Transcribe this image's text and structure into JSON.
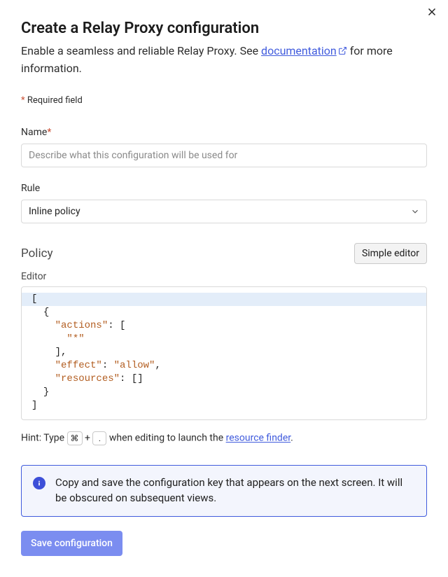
{
  "dialog": {
    "title": "Create a Relay Proxy configuration",
    "subtitle_prefix": "Enable a seamless and reliable Relay Proxy. See ",
    "subtitle_link": "documentation",
    "subtitle_suffix": " for more information.",
    "required_note": "Required field"
  },
  "form": {
    "name_label": "Name",
    "name_placeholder": "Describe what this configuration will be used for",
    "name_value": "",
    "rule_label": "Rule",
    "rule_selected": "Inline policy"
  },
  "policy": {
    "section_title": "Policy",
    "simple_editor_button": "Simple editor",
    "editor_label": "Editor",
    "code_tokens": [
      {
        "nl": true
      },
      {
        "punc": "["
      },
      {
        "nl": true
      },
      {
        "indent": 1
      },
      {
        "punc": "{"
      },
      {
        "nl": true
      },
      {
        "indent": 2
      },
      {
        "key": "\"actions\""
      },
      {
        "punc": ": ["
      },
      {
        "nl": true
      },
      {
        "indent": 3
      },
      {
        "str": "\"*\""
      },
      {
        "nl": true
      },
      {
        "indent": 2
      },
      {
        "punc": "],"
      },
      {
        "nl": true
      },
      {
        "indent": 2
      },
      {
        "key": "\"effect\""
      },
      {
        "punc": ": "
      },
      {
        "str": "\"allow\""
      },
      {
        "punc": ","
      },
      {
        "nl": true
      },
      {
        "indent": 2
      },
      {
        "key": "\"resources\""
      },
      {
        "punc": ": []"
      },
      {
        "nl": true
      },
      {
        "indent": 1
      },
      {
        "punc": "}"
      },
      {
        "nl": true
      },
      {
        "punc": "]"
      }
    ],
    "hint_prefix": "Hint: Type ",
    "hint_key1": "⌘",
    "hint_plus": " + ",
    "hint_key2": ".",
    "hint_mid": " when editing to launch the ",
    "hint_link": "resource finder",
    "hint_suffix": "."
  },
  "info": {
    "text": "Copy and save the configuration key that appears on the next screen. It will be obscured on subsequent views."
  },
  "buttons": {
    "save": "Save configuration"
  }
}
